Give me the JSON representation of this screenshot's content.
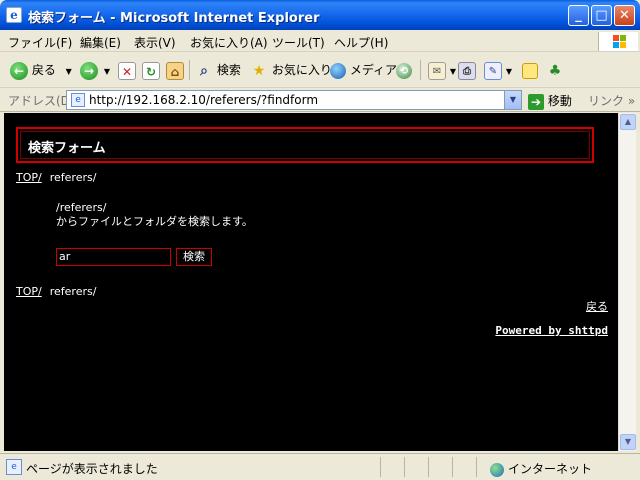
{
  "window": {
    "title": "検索フォーム - Microsoft Internet Explorer",
    "app_icon": "ie-icon",
    "buttons": {
      "minimize": "_",
      "maximize": "□",
      "close": "✕"
    }
  },
  "menu": [
    "ファイル(F)",
    "編集(E)",
    "表示(V)",
    "お気に入り(A)",
    "ツール(T)",
    "ヘルプ(H)"
  ],
  "toolbar": {
    "back": "戻る",
    "search": "検索",
    "favorites": "お気に入り",
    "media": "メディア"
  },
  "address": {
    "label": "アドレス(D)",
    "url": "http://192.168.2.10/referers/?findform",
    "go": "移動",
    "links": "リンク"
  },
  "page": {
    "heading": "検索フォーム",
    "top_link": "TOP/",
    "path": "referers/",
    "desc_path": "/referers/",
    "desc_text": "からファイルとフォルダを検索します。",
    "search_value": "ar",
    "search_button": "検索",
    "back_link": "戻る",
    "powered_by": "Powered by shttpd"
  },
  "status": {
    "text": "ページが表示されました",
    "zone": "インターネット"
  },
  "colors": {
    "title_bar": "#0a5fe0",
    "content_bg": "#000000",
    "accent_red": "#d00000"
  }
}
